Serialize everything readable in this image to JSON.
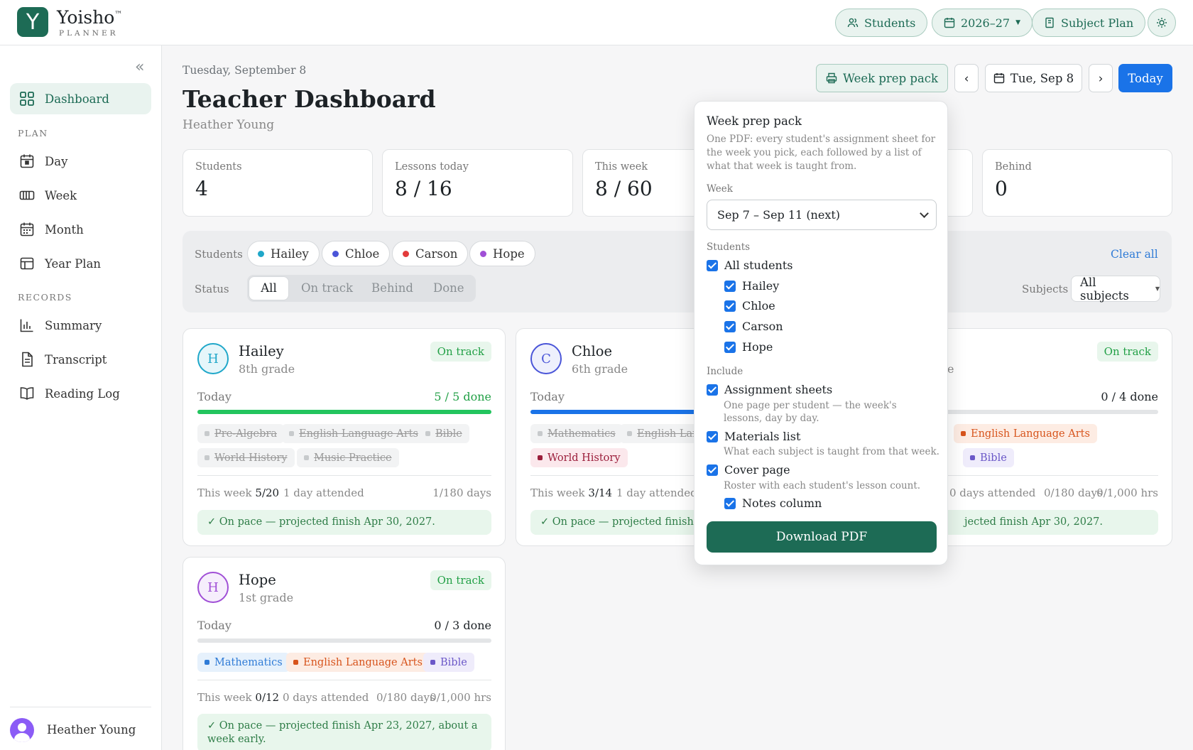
{
  "brand": {
    "name": "Yoisho",
    "tm": "™",
    "sub": "PLANNER",
    "logo_letter": "Y"
  },
  "topbar": {
    "students": "Students",
    "year": "2026–27",
    "subject_plan": "Subject Plan"
  },
  "sidebar": {
    "dashboard": "Dashboard",
    "plan_label": "PLAN",
    "day": "Day",
    "week": "Week",
    "month": "Month",
    "year_plan": "Year Plan",
    "records_label": "RECORDS",
    "summary": "Summary",
    "transcript": "Transcript",
    "reading_log": "Reading Log",
    "user": "Heather Young"
  },
  "header": {
    "date": "Tuesday, September 8",
    "title": "Teacher Dashboard",
    "teacher": "Heather Young",
    "week_prep": "Week prep pack",
    "prev": "‹",
    "current_date": "Tue, Sep 8",
    "next": "›",
    "today": "Today"
  },
  "stats": [
    {
      "label": "Students",
      "value": "4"
    },
    {
      "label": "Lessons today",
      "value": "8 / 16"
    },
    {
      "label": "This week",
      "value": "8 / 60"
    },
    {
      "label": "Behind",
      "value": "0"
    }
  ],
  "filters": {
    "students_label": "Students",
    "students": [
      {
        "name": "Hailey",
        "color": "#1fa7c9"
      },
      {
        "name": "Chloe",
        "color": "#4a55d8"
      },
      {
        "name": "Carson",
        "color": "#e23b3b"
      },
      {
        "name": "Hope",
        "color": "#a04fd6"
      }
    ],
    "status_label": "Status",
    "status": [
      "All",
      "On track",
      "Behind",
      "Done"
    ],
    "clear": "Clear all",
    "subjects_label": "Subjects",
    "subjects_value": "All subjects"
  },
  "cards": [
    {
      "initial": "H",
      "name": "Hailey",
      "grade": "8th grade",
      "badge": "On track",
      "today": "Today",
      "done": "5 / 5 done",
      "progress": 1.0,
      "bar_color": "#22c55e",
      "tags": [
        "Pre-Algebra",
        "English Language Arts",
        "Bible",
        "World History",
        "Music Practice"
      ],
      "week_label": "This week",
      "week_value": "5/20",
      "attended": "1 day attended",
      "days": "1/180 days",
      "hrs": "",
      "pace": "✓ On pace — projected finish Apr 30, 2027."
    },
    {
      "initial": "C",
      "name": "Chloe",
      "grade": "6th grade",
      "today": "Today",
      "progress": 0.6,
      "bar_color": "#1a73e8",
      "tags": [
        "Mathematics",
        "English Lan",
        "World History"
      ],
      "week_label": "This week",
      "week_value": "3/14",
      "attended": "1 day attended",
      "pace": "✓ On pace — projected finish Ap"
    },
    {
      "badge": "On track",
      "grade_tail": "e",
      "done": "0 / 4 done",
      "progress": 0,
      "tags": [
        "English Language Arts",
        "Bible"
      ],
      "attended": "0 days attended",
      "days": "0/180 days",
      "hrs": "0/1,000 hrs",
      "pace": "jected finish Apr 30, 2027."
    },
    {
      "initial": "H",
      "name": "Hope",
      "grade": "1st grade",
      "badge": "On track",
      "today": "Today",
      "done": "0 / 3 done",
      "progress": 0,
      "tags": [
        "Mathematics",
        "English Language Arts",
        "Bible"
      ],
      "week_label": "This week",
      "week_value": "0/12",
      "attended": "0 days attended",
      "days": "0/180 days",
      "hrs": "0/1,000 hrs",
      "pace": "✓ On pace — projected finish Apr 23, 2027, about a week early."
    }
  ],
  "popover": {
    "title": "Week prep pack",
    "desc": "One PDF: every student's assignment sheet for the week you pick, each followed by a list of what that week is taught from.",
    "week_label": "Week",
    "week_value": "Sep 7 – Sep 11 (next)",
    "students_label": "Students",
    "all_students": "All students",
    "students": [
      "Hailey",
      "Chloe",
      "Carson",
      "Hope"
    ],
    "include_label": "Include",
    "assignment": "Assignment sheets",
    "assignment_sub": "One page per student — the week's lessons, day by day.",
    "materials": "Materials list",
    "materials_sub": "What each subject is taught from that week.",
    "cover": "Cover page",
    "cover_sub": "Roster with each student's lesson count.",
    "notes": "Notes column",
    "download": "Download PDF"
  },
  "colors": {
    "brand": "#1d6b55",
    "accent": "#1a73e8",
    "ontrack": "#22a046"
  }
}
